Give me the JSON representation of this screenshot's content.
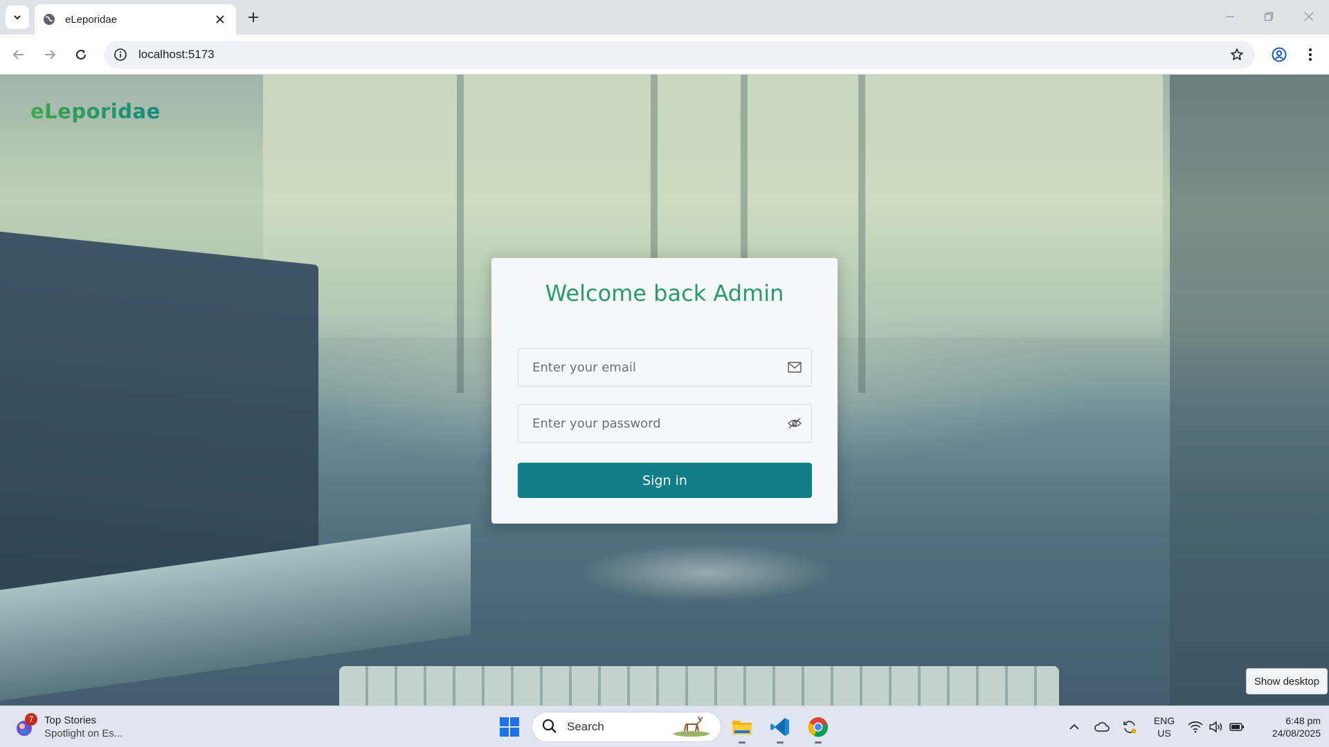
{
  "browser": {
    "tab_title": "eLeporidae",
    "url": "localhost:5173"
  },
  "page": {
    "brand": "eLeporidae",
    "heading": "Welcome back Admin",
    "email_placeholder": "Enter your email",
    "password_placeholder": "Enter your password",
    "signin_label": "Sign in",
    "show_desktop": "Show desktop"
  },
  "taskbar": {
    "widget_badge": "7",
    "widget_title": "Top Stories",
    "widget_subtitle": "Spotlight on Es...",
    "search_label": "Search",
    "lang_line1": "ENG",
    "lang_line2": "US",
    "time": "6:48 pm",
    "date": "24/08/2025"
  },
  "colors": {
    "accent_teal": "#107e86",
    "heading_green": "#2a9a6c",
    "brand_gradient_start": "#3aa84a",
    "brand_gradient_end": "#16877f"
  },
  "icons": [
    "tab-search-icon",
    "globe-icon",
    "close-icon",
    "plus-icon",
    "minimize-icon",
    "restore-icon",
    "back-icon",
    "forward-icon",
    "reload-icon",
    "info-icon",
    "star-icon",
    "profile-icon",
    "menu-icon",
    "mail-icon",
    "eye-off-icon",
    "windows-start-icon",
    "search-icon",
    "file-explorer-icon",
    "vscode-icon",
    "chrome-icon",
    "chevron-up-icon",
    "cloud-icon",
    "sync-icon",
    "wifi-icon",
    "volume-icon",
    "battery-icon"
  ]
}
